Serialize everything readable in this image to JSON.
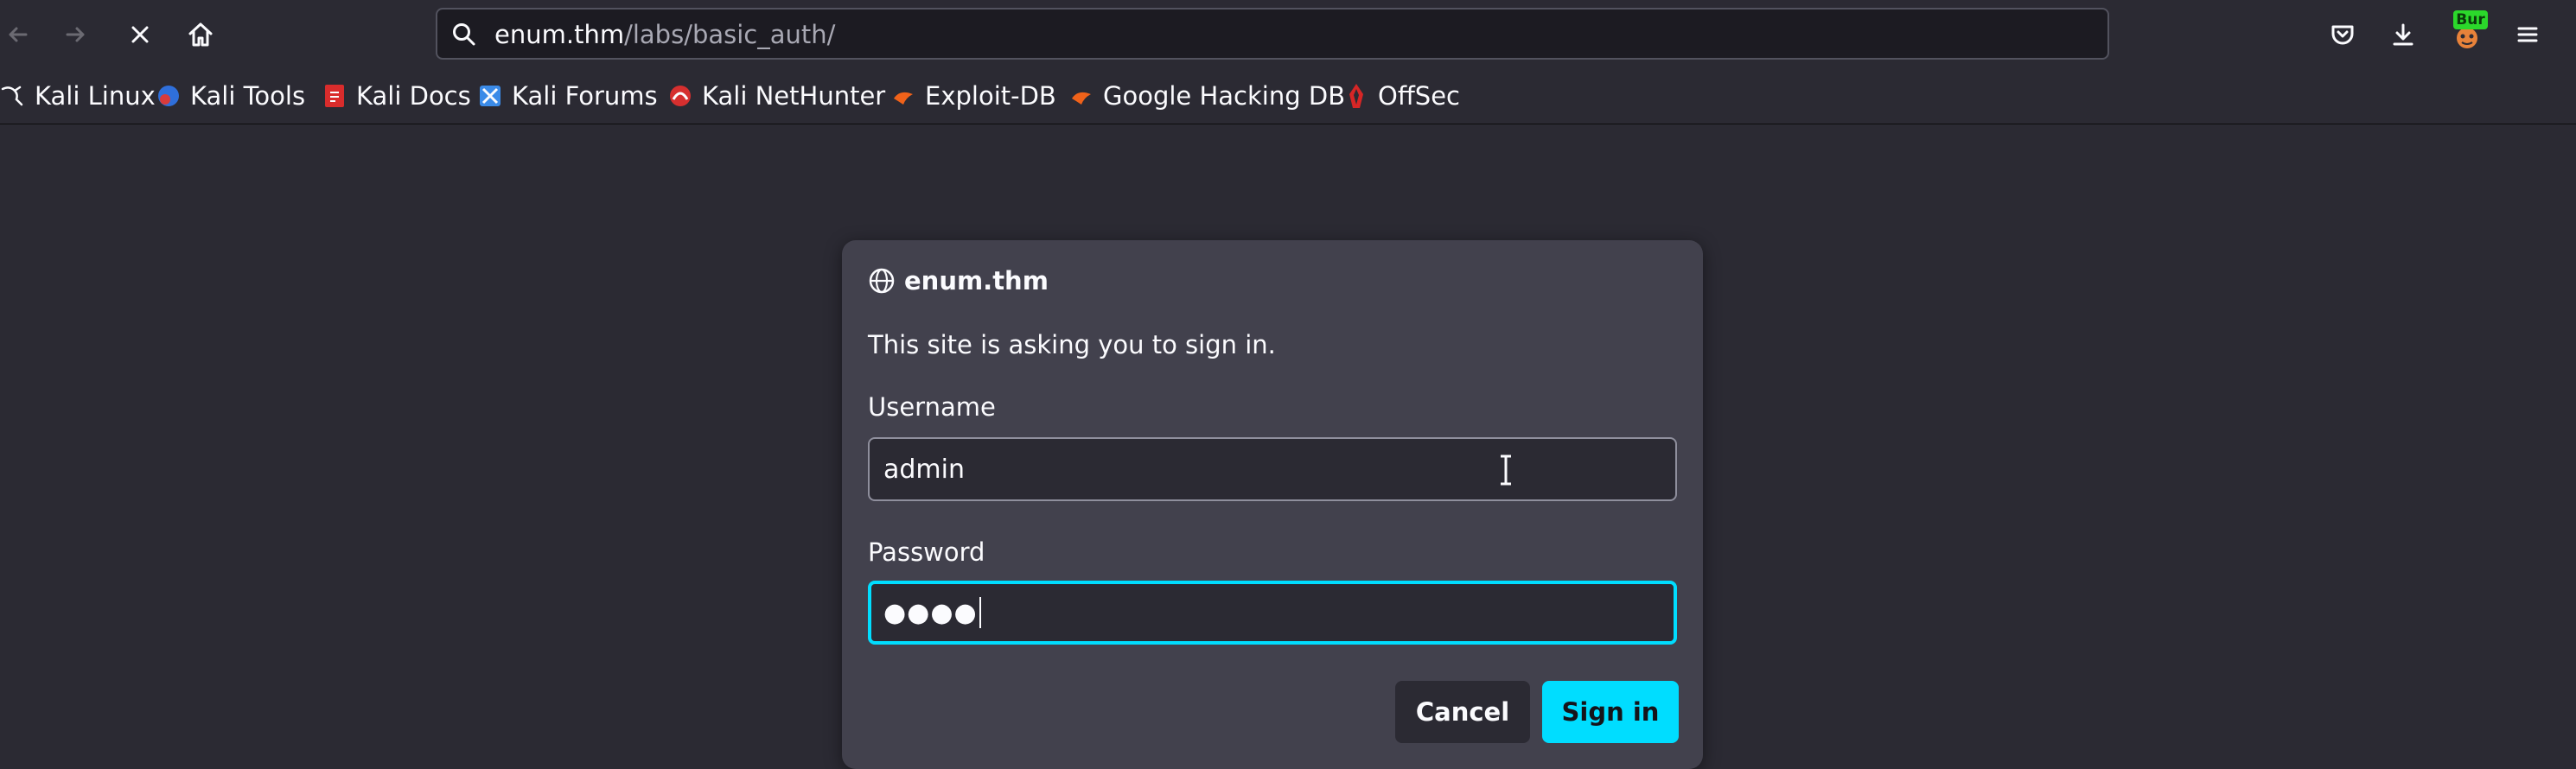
{
  "toolbar": {
    "url_host": "enum.thm",
    "url_path": "/labs/basic_auth/",
    "burp_badge": "Bur"
  },
  "bookmarks": [
    {
      "label": "Kali Linux"
    },
    {
      "label": "Kali Tools"
    },
    {
      "label": "Kali Docs"
    },
    {
      "label": "Kali Forums"
    },
    {
      "label": "Kali NetHunter"
    },
    {
      "label": "Exploit-DB"
    },
    {
      "label": "Google Hacking DB"
    },
    {
      "label": "OffSec"
    }
  ],
  "dialog": {
    "host": "enum.thm",
    "message": "This site is asking you to sign in.",
    "username_label": "Username",
    "username_value": "admin",
    "password_label": "Password",
    "password_value": "●●●●",
    "cancel_label": "Cancel",
    "signin_label": "Sign in"
  },
  "colors": {
    "background": "#2b2a33",
    "dialog": "#42414d",
    "accent": "#00ddff"
  }
}
